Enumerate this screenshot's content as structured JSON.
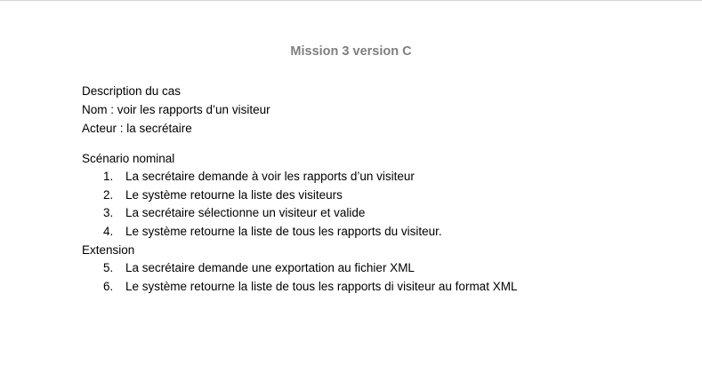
{
  "document": {
    "title": "Mission 3 version C",
    "description_heading": "Description du cas",
    "name_line": "Nom : voir les rapports d’un visiteur",
    "actor_line": "Acteur : la secrétaire",
    "scenario_heading": "Scénario nominal",
    "scenario_steps": [
      {
        "number": "1.",
        "text": "La secrétaire demande à voir les rapports d’un visiteur"
      },
      {
        "number": "2.",
        "text": "Le système retourne la liste des visiteurs"
      },
      {
        "number": "3.",
        "text": "La secrétaire sélectionne un visiteur et valide"
      },
      {
        "number": "4.",
        "text": "Le système retourne la liste de tous les rapports du visiteur."
      }
    ],
    "extension_heading": "Extension",
    "extension_steps": [
      {
        "number": "5.",
        "text": "La secrétaire demande une exportation au fichier XML"
      },
      {
        "number": "6.",
        "text": "Le système retourne la liste de tous les rapports di visiteur au format XML"
      }
    ]
  }
}
